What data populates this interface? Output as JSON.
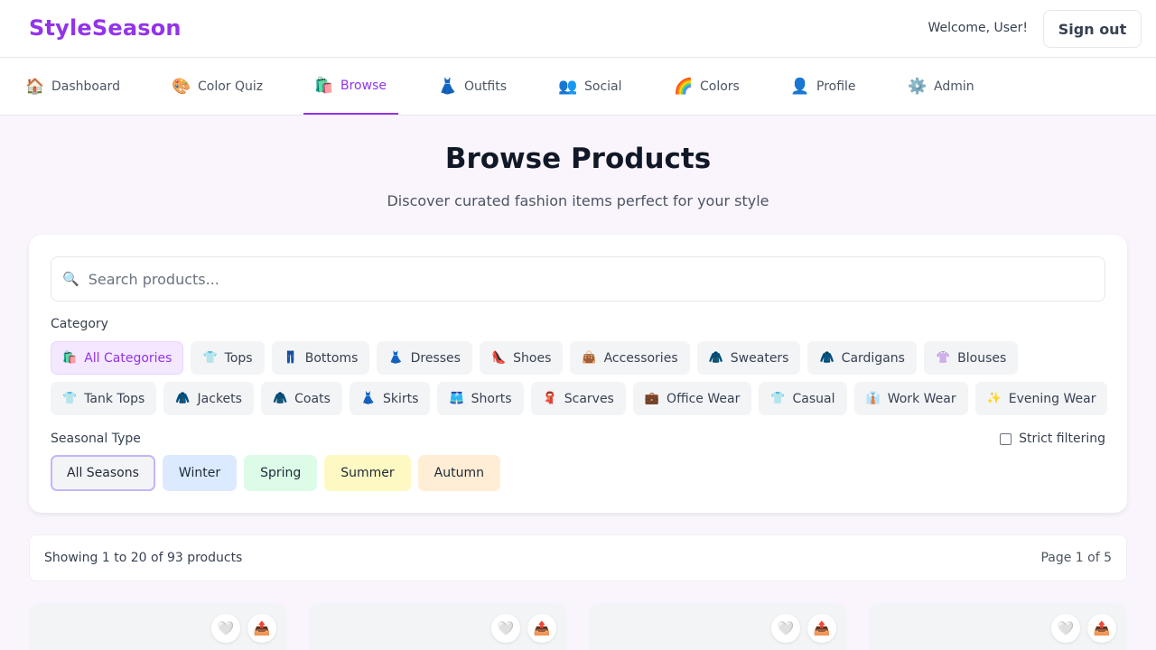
{
  "app": {
    "logo": "StyleSeason",
    "welcome": "Welcome, User!",
    "signout": "Sign out"
  },
  "nav": [
    {
      "icon": "🏠",
      "label": "Dashboard",
      "icon_name": "home-icon"
    },
    {
      "icon": "🎨",
      "label": "Color Quiz",
      "icon_name": "palette-icon"
    },
    {
      "icon": "🛍️",
      "label": "Browse",
      "icon_name": "shopping-bags-icon",
      "active": true
    },
    {
      "icon": "👗",
      "label": "Outfits",
      "icon_name": "dress-icon"
    },
    {
      "icon": "👥",
      "label": "Social",
      "icon_name": "people-icon"
    },
    {
      "icon": "🌈",
      "label": "Colors",
      "icon_name": "rainbow-icon"
    },
    {
      "icon": "👤",
      "label": "Profile",
      "icon_name": "user-icon"
    },
    {
      "icon": "⚙️",
      "label": "Admin",
      "icon_name": "gear-icon"
    }
  ],
  "page": {
    "title": "Browse Products",
    "subtitle": "Discover curated fashion items perfect for your style"
  },
  "search": {
    "icon": "🔍",
    "placeholder": "Search products..."
  },
  "filters": {
    "category_label": "Category",
    "categories_row1": [
      {
        "icon": "🛍️",
        "label": "All Categories",
        "active": true
      },
      {
        "icon": "👕",
        "label": "Tops"
      },
      {
        "icon": "👖",
        "label": "Bottoms"
      },
      {
        "icon": "👗",
        "label": "Dresses"
      },
      {
        "icon": "👠",
        "label": "Shoes"
      },
      {
        "icon": "👜",
        "label": "Accessories"
      },
      {
        "icon": "🧥",
        "label": "Sweaters"
      },
      {
        "icon": "🧥",
        "label": "Cardigans"
      },
      {
        "icon": "👚",
        "label": "Blouses"
      }
    ],
    "categories_row2": [
      {
        "icon": "👕",
        "label": "Tank Tops"
      },
      {
        "icon": "🧥",
        "label": "Jackets"
      },
      {
        "icon": "🧥",
        "label": "Coats"
      },
      {
        "icon": "👗",
        "label": "Skirts"
      },
      {
        "icon": "🩳",
        "label": "Shorts"
      },
      {
        "icon": "🧣",
        "label": "Scarves"
      },
      {
        "icon": "💼",
        "label": "Office Wear"
      },
      {
        "icon": "👕",
        "label": "Casual"
      },
      {
        "icon": "👔",
        "label": "Work Wear"
      },
      {
        "icon": "✨",
        "label": "Evening Wear"
      }
    ],
    "season_label": "Seasonal Type",
    "seasons": [
      {
        "label": "All Seasons",
        "bg": "#f3f4f6",
        "border": "#c4b5fd",
        "active": true
      },
      {
        "label": "Winter",
        "bg": "#dbeafe"
      },
      {
        "label": "Spring",
        "bg": "#dcfce7"
      },
      {
        "label": "Summer",
        "bg": "#fef9c3"
      },
      {
        "label": "Autumn",
        "bg": "#ffedd5"
      }
    ],
    "strict_label": "Strict filtering",
    "strict_checked": false
  },
  "results": {
    "showing": "Showing 1 to 20 of 93 products",
    "page": "Page 1 of 5"
  },
  "product_cards": [
    {
      "favorite_icon": "🤍",
      "share_icon": "📤"
    },
    {
      "favorite_icon": "🤍",
      "share_icon": "📤"
    },
    {
      "favorite_icon": "🤍",
      "share_icon": "📤"
    },
    {
      "favorite_icon": "🤍",
      "share_icon": "📤"
    }
  ],
  "colors": {
    "accent": "#9333ea",
    "accent_light": "#f3e8ff",
    "page_bg": "#faf5fd"
  }
}
